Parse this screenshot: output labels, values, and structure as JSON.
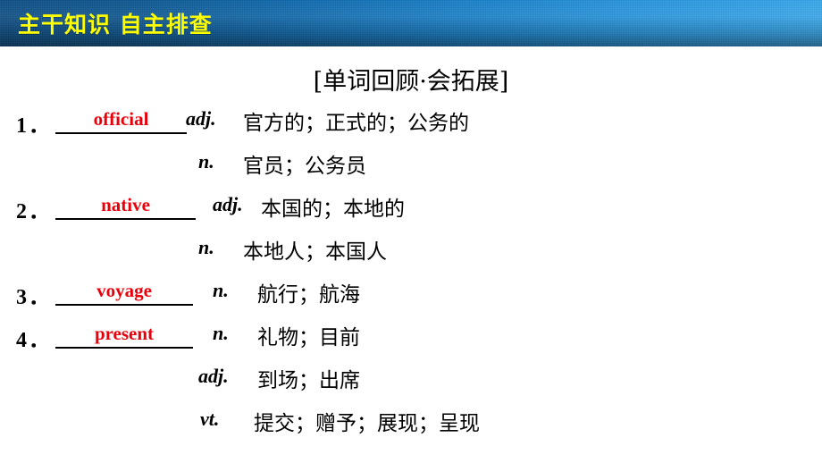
{
  "banner": {
    "title": "主干知识  自主排查",
    "text_color": "#FFFF00",
    "gradient_from": "#0E4F86",
    "gradient_to": "#3AA9EC"
  },
  "section": {
    "heading": "[单词回顾·会拓展]"
  },
  "answer_color": "#E8000B",
  "entries": [
    {
      "number": "1．",
      "answer": "official",
      "lines": [
        {
          "pos": "adj.",
          "meaning": "官方的；正式的；公务的"
        },
        {
          "pos": "n.",
          "meaning": "官员；公务员"
        }
      ]
    },
    {
      "number": "2．",
      "answer": "native",
      "lines": [
        {
          "pos": "adj.",
          "meaning": "本国的；本地的"
        },
        {
          "pos": "n.",
          "meaning": "本地人；本国人"
        }
      ]
    },
    {
      "number": "3．",
      "answer": "voyage",
      "lines": [
        {
          "pos": "n.",
          "meaning": "航行；航海"
        }
      ]
    },
    {
      "number": "4．",
      "answer": "present",
      "lines": [
        {
          "pos": "n.",
          "meaning": "礼物；目前"
        },
        {
          "pos": "adj.",
          "meaning": "到场；出席"
        },
        {
          "pos": "vt.",
          "meaning": "提交；赠予；展现；呈现"
        }
      ]
    }
  ]
}
